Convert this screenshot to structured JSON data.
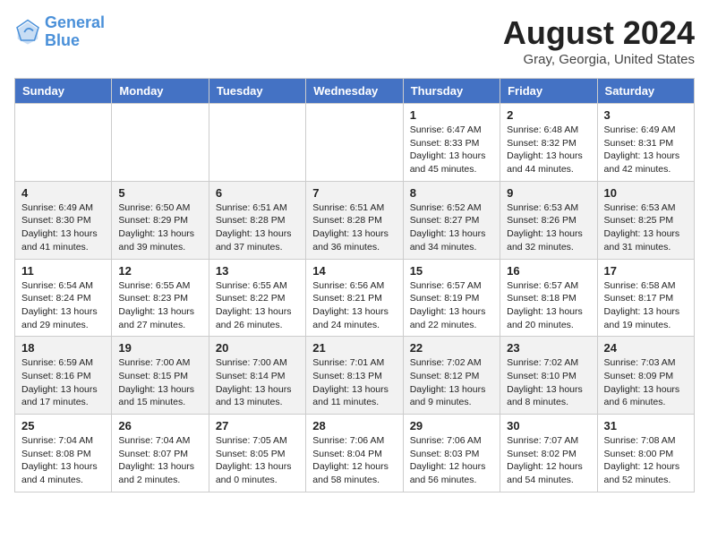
{
  "header": {
    "logo_line1": "General",
    "logo_line2": "Blue",
    "month_year": "August 2024",
    "location": "Gray, Georgia, United States"
  },
  "weekdays": [
    "Sunday",
    "Monday",
    "Tuesday",
    "Wednesday",
    "Thursday",
    "Friday",
    "Saturday"
  ],
  "weeks": [
    [
      {
        "day": "",
        "info": ""
      },
      {
        "day": "",
        "info": ""
      },
      {
        "day": "",
        "info": ""
      },
      {
        "day": "",
        "info": ""
      },
      {
        "day": "1",
        "info": "Sunrise: 6:47 AM\nSunset: 8:33 PM\nDaylight: 13 hours\nand 45 minutes."
      },
      {
        "day": "2",
        "info": "Sunrise: 6:48 AM\nSunset: 8:32 PM\nDaylight: 13 hours\nand 44 minutes."
      },
      {
        "day": "3",
        "info": "Sunrise: 6:49 AM\nSunset: 8:31 PM\nDaylight: 13 hours\nand 42 minutes."
      }
    ],
    [
      {
        "day": "4",
        "info": "Sunrise: 6:49 AM\nSunset: 8:30 PM\nDaylight: 13 hours\nand 41 minutes."
      },
      {
        "day": "5",
        "info": "Sunrise: 6:50 AM\nSunset: 8:29 PM\nDaylight: 13 hours\nand 39 minutes."
      },
      {
        "day": "6",
        "info": "Sunrise: 6:51 AM\nSunset: 8:28 PM\nDaylight: 13 hours\nand 37 minutes."
      },
      {
        "day": "7",
        "info": "Sunrise: 6:51 AM\nSunset: 8:28 PM\nDaylight: 13 hours\nand 36 minutes."
      },
      {
        "day": "8",
        "info": "Sunrise: 6:52 AM\nSunset: 8:27 PM\nDaylight: 13 hours\nand 34 minutes."
      },
      {
        "day": "9",
        "info": "Sunrise: 6:53 AM\nSunset: 8:26 PM\nDaylight: 13 hours\nand 32 minutes."
      },
      {
        "day": "10",
        "info": "Sunrise: 6:53 AM\nSunset: 8:25 PM\nDaylight: 13 hours\nand 31 minutes."
      }
    ],
    [
      {
        "day": "11",
        "info": "Sunrise: 6:54 AM\nSunset: 8:24 PM\nDaylight: 13 hours\nand 29 minutes."
      },
      {
        "day": "12",
        "info": "Sunrise: 6:55 AM\nSunset: 8:23 PM\nDaylight: 13 hours\nand 27 minutes."
      },
      {
        "day": "13",
        "info": "Sunrise: 6:55 AM\nSunset: 8:22 PM\nDaylight: 13 hours\nand 26 minutes."
      },
      {
        "day": "14",
        "info": "Sunrise: 6:56 AM\nSunset: 8:21 PM\nDaylight: 13 hours\nand 24 minutes."
      },
      {
        "day": "15",
        "info": "Sunrise: 6:57 AM\nSunset: 8:19 PM\nDaylight: 13 hours\nand 22 minutes."
      },
      {
        "day": "16",
        "info": "Sunrise: 6:57 AM\nSunset: 8:18 PM\nDaylight: 13 hours\nand 20 minutes."
      },
      {
        "day": "17",
        "info": "Sunrise: 6:58 AM\nSunset: 8:17 PM\nDaylight: 13 hours\nand 19 minutes."
      }
    ],
    [
      {
        "day": "18",
        "info": "Sunrise: 6:59 AM\nSunset: 8:16 PM\nDaylight: 13 hours\nand 17 minutes."
      },
      {
        "day": "19",
        "info": "Sunrise: 7:00 AM\nSunset: 8:15 PM\nDaylight: 13 hours\nand 15 minutes."
      },
      {
        "day": "20",
        "info": "Sunrise: 7:00 AM\nSunset: 8:14 PM\nDaylight: 13 hours\nand 13 minutes."
      },
      {
        "day": "21",
        "info": "Sunrise: 7:01 AM\nSunset: 8:13 PM\nDaylight: 13 hours\nand 11 minutes."
      },
      {
        "day": "22",
        "info": "Sunrise: 7:02 AM\nSunset: 8:12 PM\nDaylight: 13 hours\nand 9 minutes."
      },
      {
        "day": "23",
        "info": "Sunrise: 7:02 AM\nSunset: 8:10 PM\nDaylight: 13 hours\nand 8 minutes."
      },
      {
        "day": "24",
        "info": "Sunrise: 7:03 AM\nSunset: 8:09 PM\nDaylight: 13 hours\nand 6 minutes."
      }
    ],
    [
      {
        "day": "25",
        "info": "Sunrise: 7:04 AM\nSunset: 8:08 PM\nDaylight: 13 hours\nand 4 minutes."
      },
      {
        "day": "26",
        "info": "Sunrise: 7:04 AM\nSunset: 8:07 PM\nDaylight: 13 hours\nand 2 minutes."
      },
      {
        "day": "27",
        "info": "Sunrise: 7:05 AM\nSunset: 8:05 PM\nDaylight: 13 hours\nand 0 minutes."
      },
      {
        "day": "28",
        "info": "Sunrise: 7:06 AM\nSunset: 8:04 PM\nDaylight: 12 hours\nand 58 minutes."
      },
      {
        "day": "29",
        "info": "Sunrise: 7:06 AM\nSunset: 8:03 PM\nDaylight: 12 hours\nand 56 minutes."
      },
      {
        "day": "30",
        "info": "Sunrise: 7:07 AM\nSunset: 8:02 PM\nDaylight: 12 hours\nand 54 minutes."
      },
      {
        "day": "31",
        "info": "Sunrise: 7:08 AM\nSunset: 8:00 PM\nDaylight: 12 hours\nand 52 minutes."
      }
    ]
  ]
}
